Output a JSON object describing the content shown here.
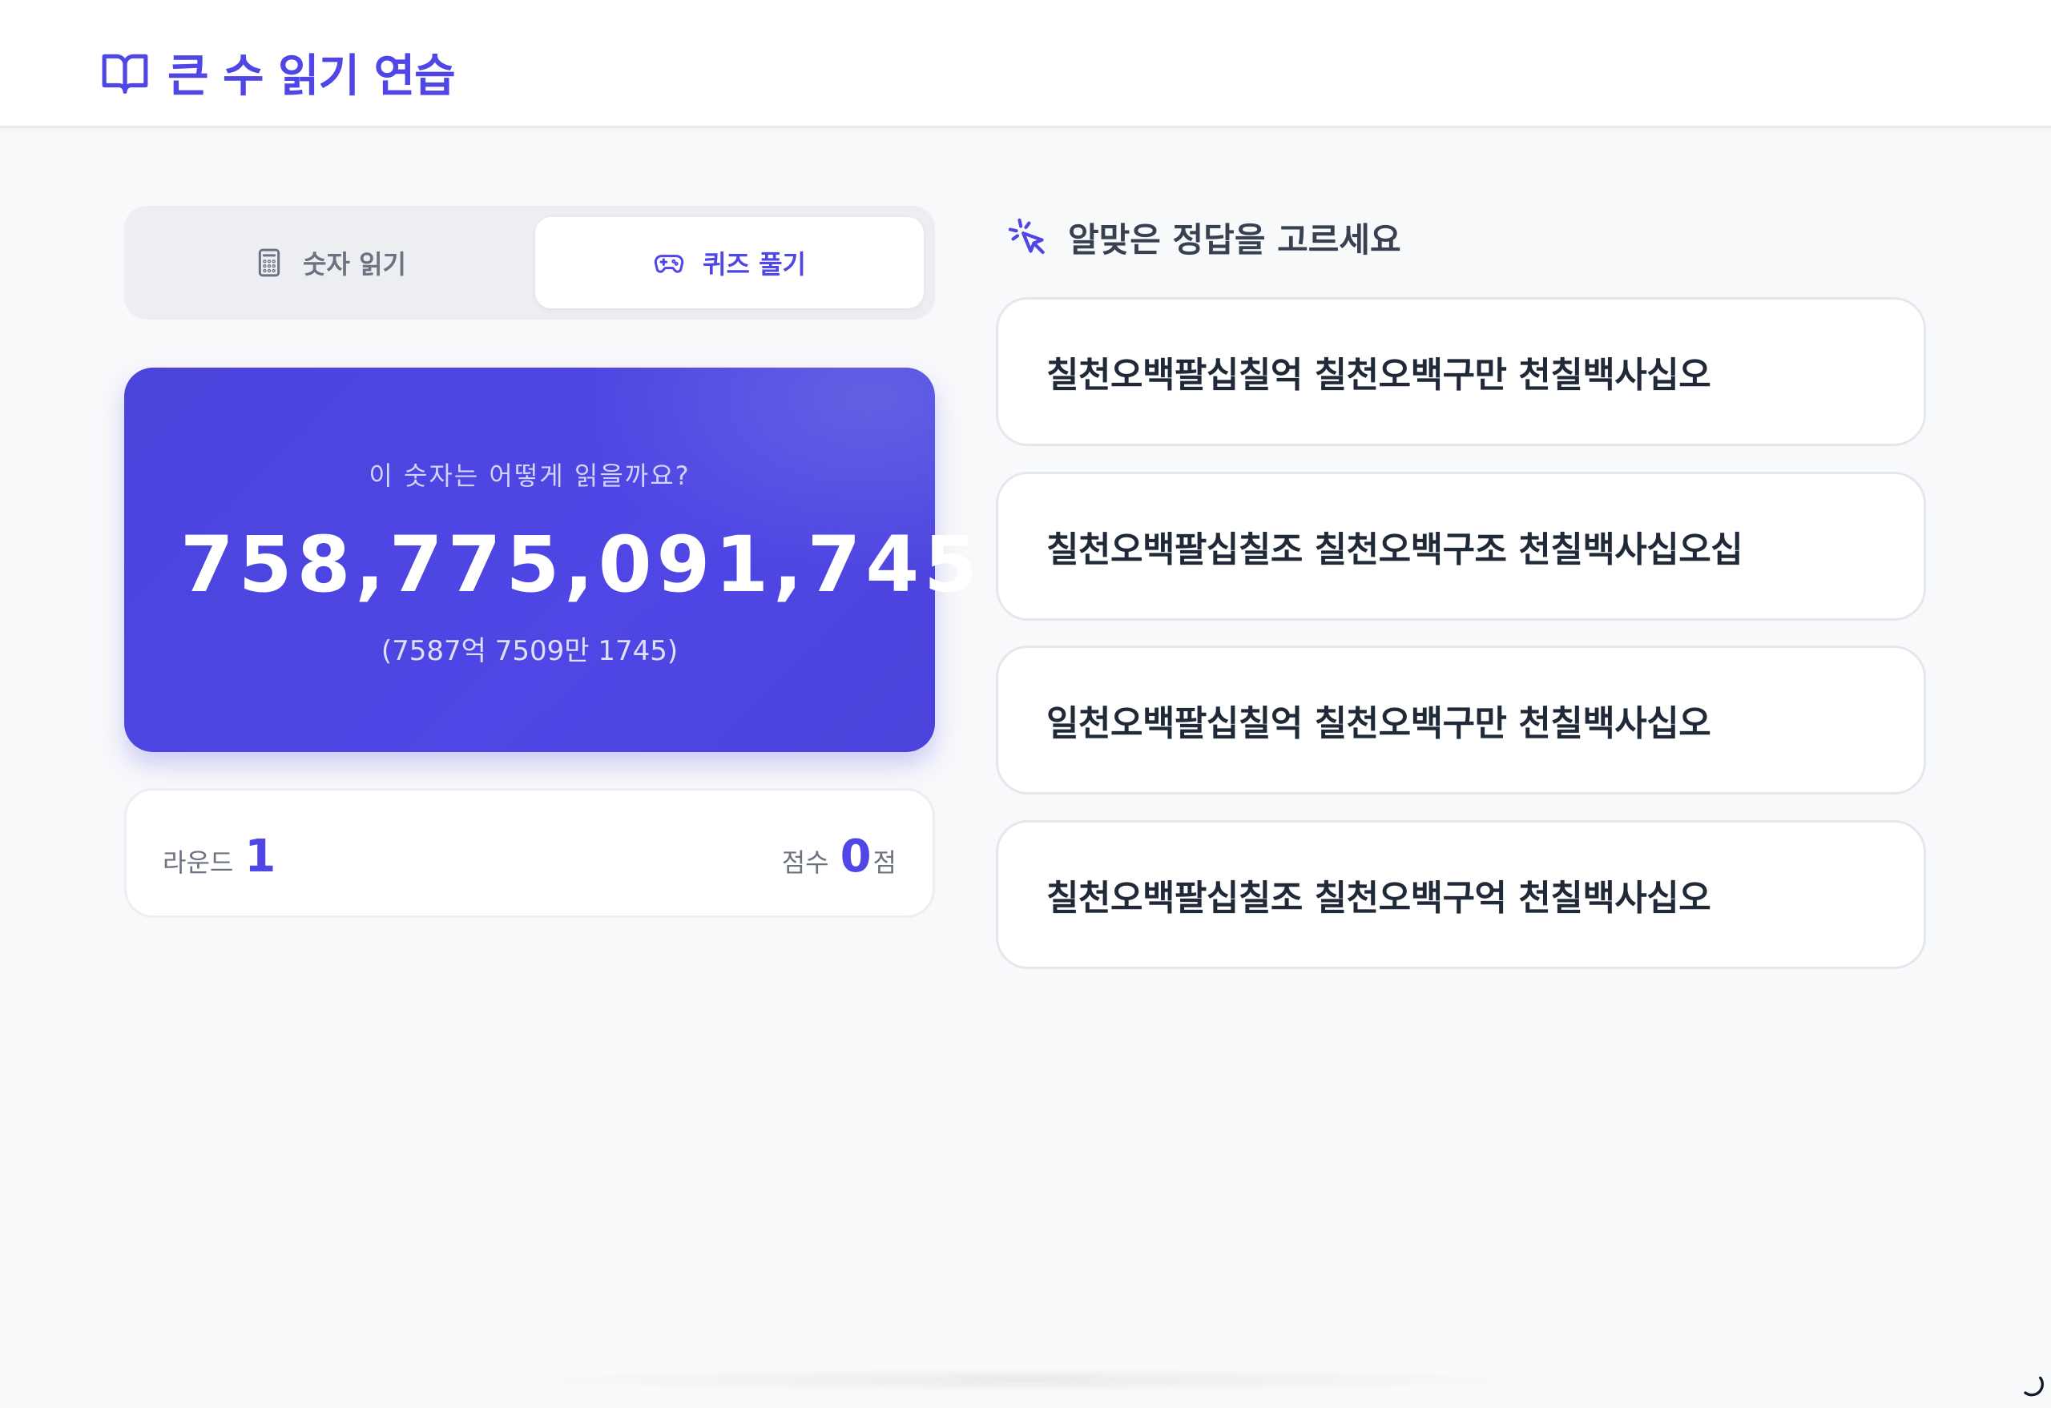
{
  "header": {
    "title": "큰 수 읽기 연습",
    "icon": "book-open-icon"
  },
  "tabs": [
    {
      "label": "숫자 읽기",
      "icon": "calculator-icon",
      "active": false
    },
    {
      "label": "퀴즈 풀기",
      "icon": "gamepad-icon",
      "active": true
    }
  ],
  "card": {
    "question": "이 숫자는 어떻게 읽을까요?",
    "number": "758,775,091,745",
    "grouped": "(7587억 7509만 1745)"
  },
  "stats": {
    "round_label": "라운드",
    "round_value": "1",
    "score_label": "점수",
    "score_value": "0",
    "score_unit": "점"
  },
  "quiz": {
    "prompt": "알맞은 정답을 고르세요",
    "prompt_icon": "cursor-click-icon",
    "options": [
      "칠천오백팔십칠억 칠천오백구만 천칠백사십오",
      "칠천오백팔십칠조 칠천오백구조 천칠백사십오십",
      "일천오백팔십칠억 칠천오백구만 천칠백사십오",
      "칠천오백팔십칠조 칠천오백구억 천칠백사십오"
    ]
  },
  "colors": {
    "accent": "#4f46e5",
    "background": "#f8f9fb",
    "card_border": "#e4e7ec"
  }
}
